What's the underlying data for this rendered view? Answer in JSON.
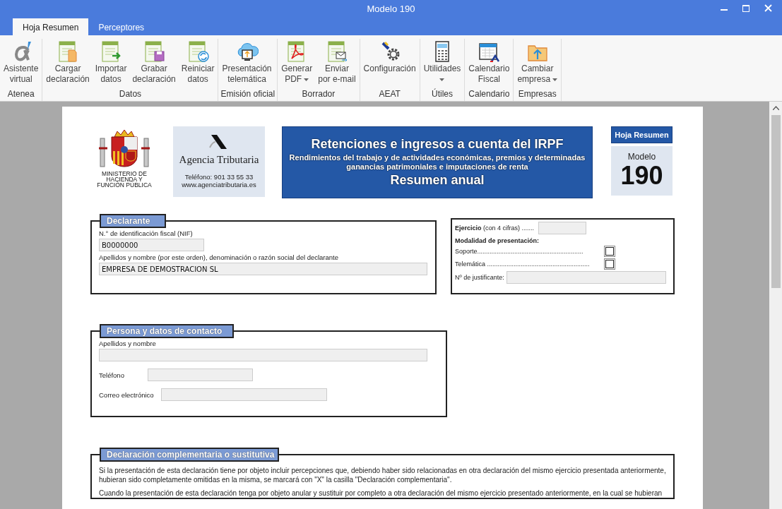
{
  "window": {
    "title": "Modelo 190"
  },
  "tabs": [
    {
      "label": "Hoja Resumen",
      "selected": true
    },
    {
      "label": "Perceptores",
      "selected": false
    }
  ],
  "ribbon": [
    {
      "label": "Atenea",
      "buttons": [
        {
          "lines": [
            "Asistente",
            "virtual"
          ],
          "dropdown": false
        }
      ]
    },
    {
      "label": "Datos",
      "buttons": [
        {
          "lines": [
            "Cargar",
            "declaración"
          ],
          "dropdown": false
        },
        {
          "lines": [
            "Importar",
            "datos"
          ],
          "dropdown": false
        },
        {
          "lines": [
            "Grabar",
            "declaración"
          ],
          "dropdown": false
        },
        {
          "lines": [
            "Reiniciar",
            "datos"
          ],
          "dropdown": false
        }
      ]
    },
    {
      "label": "Emisión oficial",
      "buttons": [
        {
          "lines": [
            "Presentación",
            "telemática"
          ],
          "dropdown": false
        }
      ]
    },
    {
      "label": "Borrador",
      "buttons": [
        {
          "lines": [
            "Generar",
            "PDF"
          ],
          "dropdown": true
        },
        {
          "lines": [
            "Enviar",
            "por e-mail"
          ],
          "dropdown": false
        }
      ]
    },
    {
      "label": "AEAT",
      "buttons": [
        {
          "lines": [
            "Configuración"
          ],
          "dropdown": false
        }
      ]
    },
    {
      "label": "Útiles",
      "buttons": [
        {
          "lines": [
            "Utilidades"
          ],
          "dropdown": true
        }
      ]
    },
    {
      "label": "Calendario",
      "buttons": [
        {
          "lines": [
            "Calendario",
            "Fiscal"
          ],
          "dropdown": false
        }
      ]
    },
    {
      "label": "Empresas",
      "buttons": [
        {
          "lines": [
            "Cambiar",
            "empresa"
          ],
          "dropdown": true
        }
      ]
    }
  ],
  "document": {
    "ministry": [
      "MINISTERIO DE",
      "HACIENDA Y",
      "FUNCIÓN PÚBLICA"
    ],
    "agency": {
      "name": "Agencia Tributaria",
      "phone": "Teléfono: 901 33 55 33",
      "web": "www.agenciatributaria.es"
    },
    "banner": {
      "title": "Retenciones e ingresos a cuenta del IRPF",
      "subtitle": "Rendimientos del trabajo y de actividades económicas, premios y determinadas ganancias patrimoniales e imputaciones de renta",
      "footer": "Resumen anual"
    },
    "sheet": {
      "label": "Hoja Resumen",
      "model_label": "Modelo",
      "model_number": "190"
    },
    "declarante": {
      "legend": "Declarante",
      "fields": [
        {
          "kind": "stacked",
          "label": "N.° de identificación fiscal (NIF)",
          "value": "B0000000"
        },
        {
          "kind": "stacked",
          "label": "Apellidos y nombre (por este orden), denominación o razón social del declarante",
          "value": "EMPRESA DE DEMOSTRACION SL"
        }
      ]
    },
    "presentacion": {
      "ejercicio_label": "**Ejercicio** (con 4 cifras)  .......",
      "modalidad_label": "Modalidad de presentación:",
      "options": [
        {
          "label": "Soporte............................................................",
          "checked": false
        },
        {
          "label": "Telemática ..........................................................",
          "checked": false
        }
      ],
      "justificante_label": "Nº de justificante:"
    },
    "contacto": {
      "legend": "Persona y datos de contacto",
      "fields": [
        {
          "kind": "stacked",
          "label": "Apellidos y nombre"
        },
        {
          "kind": "inline",
          "label": "Teléfono"
        },
        {
          "kind": "inline",
          "label": "Correo electrónico"
        }
      ]
    },
    "complementaria": {
      "legend": "Declaración complementaria o sustitutiva",
      "paragraphs": [
        "Si la presentación de esta declaración tiene por objeto incluir percepciones que, debiendo haber sido relacionadas en otra declaración del mismo ejercicio presentada anteriormente, hubieran sido completamente omitidas en la misma, se marcará con \"X\" la casilla \"Declaración complementaria\".",
        "Cuando la presentación de esta declaración tenga por objeto anular y sustituir por completo a otra declaración del mismo ejercicio presentado anteriormente, en la cual se hubieran"
      ]
    }
  }
}
